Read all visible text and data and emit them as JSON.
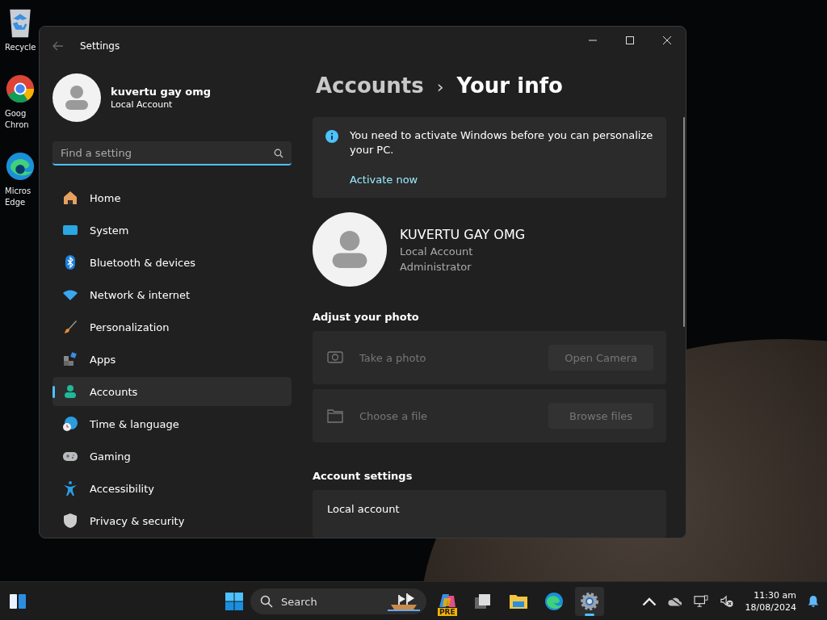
{
  "desktop_icons": [
    {
      "lines": [
        "Recycle"
      ]
    },
    {
      "lines": [
        "Goog",
        "Chron"
      ]
    },
    {
      "lines": [
        "Micros",
        "Edge"
      ]
    }
  ],
  "window": {
    "title": "Settings"
  },
  "profile": {
    "name": "kuvertu gay omg",
    "type": "Local Account"
  },
  "search": {
    "placeholder": "Find a setting"
  },
  "nav": [
    {
      "label": "Home",
      "selected": false
    },
    {
      "label": "System",
      "selected": false
    },
    {
      "label": "Bluetooth & devices",
      "selected": false
    },
    {
      "label": "Network & internet",
      "selected": false
    },
    {
      "label": "Personalization",
      "selected": false
    },
    {
      "label": "Apps",
      "selected": false
    },
    {
      "label": "Accounts",
      "selected": true
    },
    {
      "label": "Time & language",
      "selected": false
    },
    {
      "label": "Gaming",
      "selected": false
    },
    {
      "label": "Accessibility",
      "selected": false
    },
    {
      "label": "Privacy & security",
      "selected": false
    }
  ],
  "breadcrumb": {
    "parent": "Accounts",
    "separator": "›",
    "current": "Your info"
  },
  "notice": {
    "text": "You need to activate Windows before you can personalize your PC.",
    "link": "Activate now"
  },
  "user": {
    "name": "KUVERTU GAY OMG",
    "lines": [
      "Local Account",
      "Administrator"
    ]
  },
  "adjust_photo": {
    "heading": "Adjust your photo",
    "rows": [
      {
        "kind": "camera",
        "label": "Take a photo",
        "button": "Open Camera",
        "disabled": true
      },
      {
        "kind": "file",
        "label": "Choose a file",
        "button": "Browse files",
        "disabled": true
      }
    ]
  },
  "account_settings": {
    "heading": "Account settings",
    "rows": [
      {
        "label": "Local account"
      }
    ]
  },
  "taskbar": {
    "search_placeholder": "Search",
    "copilot_badge": "PRE",
    "time": "11:30 am",
    "date": "18/08/2024",
    "apps": [
      {
        "kind": "copilot",
        "selected": false
      },
      {
        "kind": "taskview",
        "selected": false
      },
      {
        "kind": "explorer",
        "selected": false
      },
      {
        "kind": "edge",
        "selected": false
      },
      {
        "kind": "settings",
        "selected": true
      }
    ]
  }
}
